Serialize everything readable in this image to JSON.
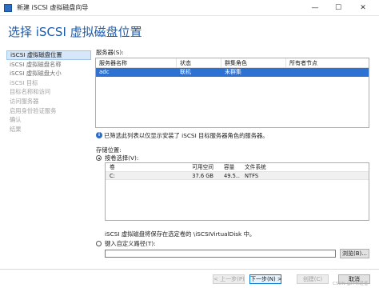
{
  "window": {
    "title": "新建 iSCSI 虚拟磁盘向导",
    "minimize": "—",
    "maximize": "☐",
    "close": "✕"
  },
  "page": {
    "heading": "选择 iSCSI 虚拟磁盘位置"
  },
  "nav": {
    "items": [
      {
        "label": "iSCSI 虚拟磁盘位置",
        "state": "active"
      },
      {
        "label": "iSCSI 虚拟磁盘名称",
        "state": "mid"
      },
      {
        "label": "iSCSI 虚拟磁盘大小",
        "state": "mid"
      },
      {
        "label": "iSCSI 目标",
        "state": "disabled"
      },
      {
        "label": "目标名称和访问",
        "state": "disabled"
      },
      {
        "label": "访问服务器",
        "state": "disabled"
      },
      {
        "label": "启用身份验证服务",
        "state": "disabled"
      },
      {
        "label": "确认",
        "state": "disabled"
      },
      {
        "label": "结果",
        "state": "disabled"
      }
    ]
  },
  "servers": {
    "label": "服务器(S):",
    "columns": [
      "服务器名称",
      "状态",
      "群集角色",
      "所有者节点"
    ],
    "rows": [
      {
        "name": "adc",
        "status": "联机",
        "role": "未群集",
        "owner": ""
      }
    ]
  },
  "info": {
    "icon": "info-icon",
    "text": "已筛选此列表以仅显示安装了 iSCSI 目标服务器角色的服务器。"
  },
  "storage": {
    "label": "存储位置:",
    "by_volume_label": "按卷选择(V):",
    "volume_columns": [
      "卷",
      "可用空间",
      "容量",
      "文件系统"
    ],
    "volumes": [
      {
        "volume": "C:",
        "free": "37.6 GB",
        "capacity": "49.5...",
        "fs": "NTFS"
      }
    ],
    "save_note": "iSCSI 虚拟磁盘将保存在选定卷的 \\iSCSIVirtualDisk 中。",
    "custom_path_label": "键入自定义路径(T):",
    "custom_path_value": "",
    "browse_label": "浏览(B)..."
  },
  "footer": {
    "back_label": "< 上一步(P)",
    "next_label": "下一步(N) >",
    "create_label": "创建(C)",
    "cancel_label": "取消"
  },
  "watermark": "CSDN @IT布道者"
}
